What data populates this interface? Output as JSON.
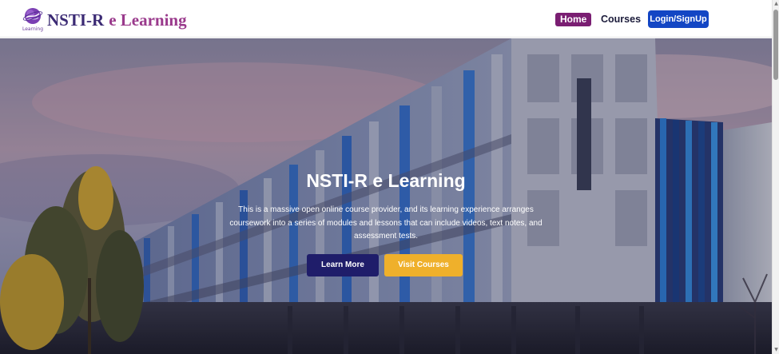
{
  "brand": {
    "name_part1": "NSTI-R",
    "name_part2": "e Learning",
    "logo_caption": "Learning",
    "logo_icon": "globe-logo-icon"
  },
  "nav": {
    "home": "Home",
    "courses": "Courses",
    "login": "Login/SignUp"
  },
  "hero": {
    "title": "NSTI-R e Learning",
    "description": "This is a massive open online course provider, and its learning experience arranges coursework into a series of modules and lessons that can include videos, text notes, and assessment tests.",
    "learn_more": "Learn More",
    "visit_courses": "Visit Courses"
  },
  "scrollbar": {
    "up_icon": "scroll-up-arrow-icon",
    "down_icon": "scroll-down-arrow-icon"
  },
  "colors": {
    "home_bg": "#7a1e72",
    "login_bg": "#1346c4",
    "learn_more_bg": "#1f1d6a",
    "visit_courses_bg": "#efb02b",
    "brand_dark": "#3b2a74",
    "brand_purple": "#9a3a8c"
  }
}
